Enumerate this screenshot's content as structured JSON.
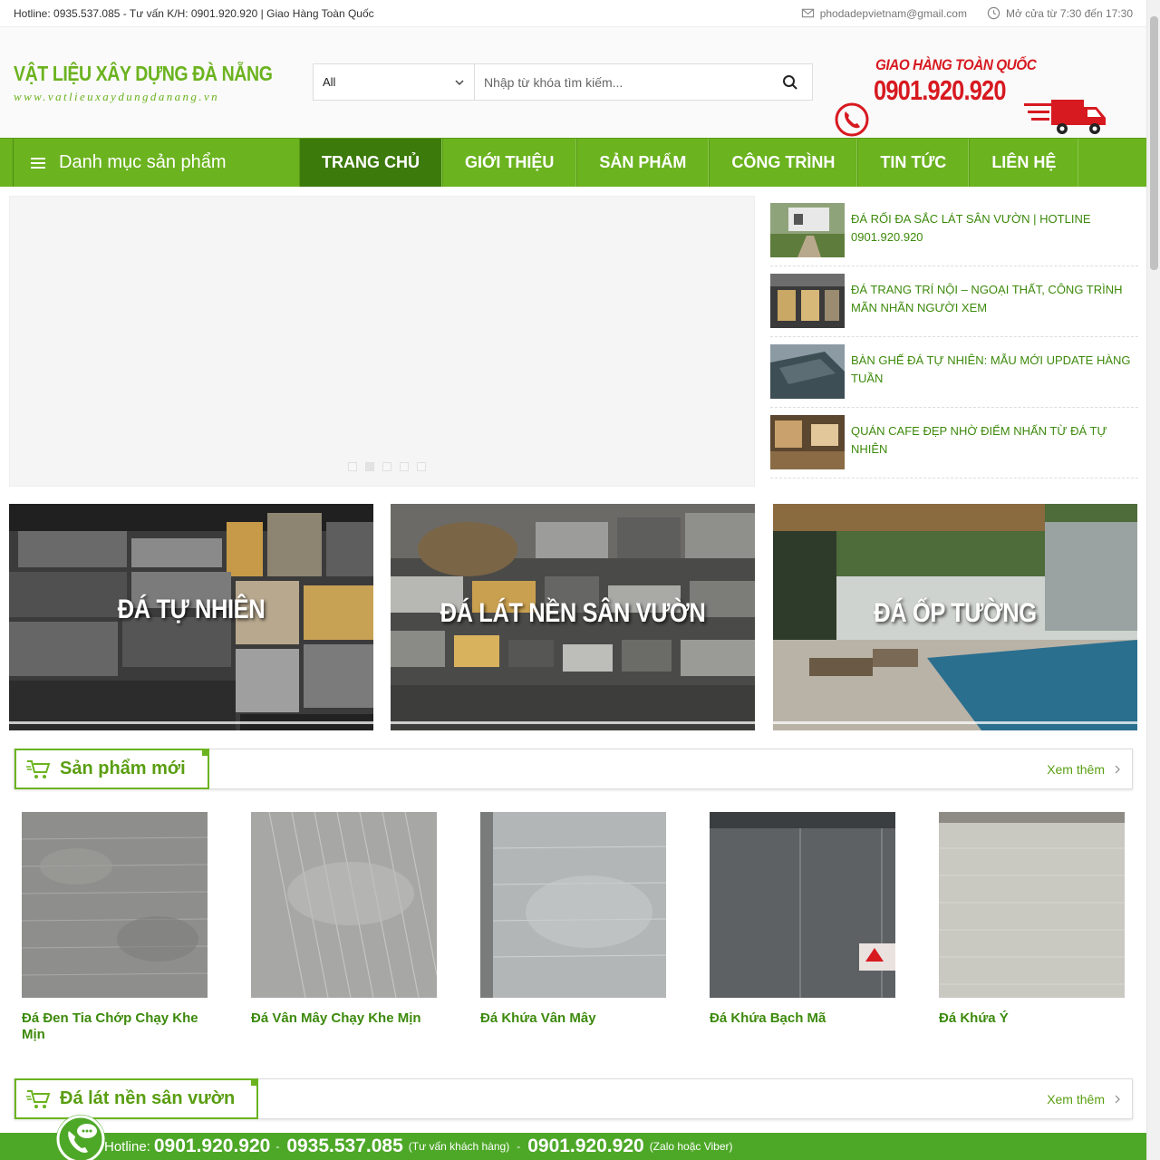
{
  "topbar": {
    "hotline_text": "Hotline: 0935.537.085 - Tư vấn K/H: 0901.920.920 | Giao Hàng Toàn Quốc",
    "email": "phodadepvietnam@gmail.com",
    "hours": "Mở cửa từ 7:30 đến 17:30"
  },
  "logo": {
    "brand": "VẬT LIỆU XÂY DỰNG ĐÀ NẴNG",
    "url": "www.vatlieuxaydungdanang.vn"
  },
  "search": {
    "category": "All",
    "placeholder": "Nhập từ khóa tìm kiếm..."
  },
  "hotline_banner": {
    "label": "GIAO HÀNG TOÀN QUỐC",
    "number": "0901.920.920"
  },
  "nav": {
    "category_label": "Danh mục sản phẩm",
    "items": [
      "TRANG CHỦ",
      "GIỚI THIỆU",
      "SẢN PHẨM",
      "CÔNG TRÌNH",
      "TIN TỨC",
      "LIÊN HỆ"
    ],
    "active_index": 0
  },
  "news": [
    {
      "title": "ĐÁ RỐI ĐA SẮC LÁT SÂN VƯỜN | HOTLINE 0901.920.920"
    },
    {
      "title": "ĐÁ TRANG TRÍ NỘI – NGOẠI THẤT, CÔNG TRÌNH MÃN NHÃN NGƯỜI XEM"
    },
    {
      "title": "BÀN GHẾ ĐÁ TỰ NHIÊN: MẪU MỚI UPDATE HÀNG TUẦN"
    },
    {
      "title": "QUÁN CAFE ĐẸP NHỜ ĐIỂM NHẤN TỪ ĐÁ TỰ NHIÊN"
    }
  ],
  "banners": [
    {
      "label": "ĐÁ TỰ NHIÊN"
    },
    {
      "label": "ĐÁ LÁT NỀN SÂN VƯỜN"
    },
    {
      "label": "ĐÁ ỐP TƯỜNG"
    }
  ],
  "sections": [
    {
      "title": "Sản phẩm mới",
      "more": "Xem thêm"
    },
    {
      "title": "Đá lát nền sân vườn",
      "more": "Xem thêm"
    }
  ],
  "products": [
    {
      "name": "Đá Đen Tia Chớp Chạy Khe Mịn"
    },
    {
      "name": "Đá Vân Mây Chạy Khe Mịn"
    },
    {
      "name": "Đá Khứa Vân Mây"
    },
    {
      "name": "Đá Khứa Bạch Mã"
    },
    {
      "name": "Đá Khứa Ý"
    }
  ],
  "footer": {
    "label": "Hotline:",
    "number1": "0901.920.920",
    "sep": "-",
    "number2": "0935.537.085",
    "note2": "(Tư vấn khách hàng)",
    "number3": "0901.920.920",
    "note3": "(Zalo hoặc Viber)"
  },
  "colors": {
    "brand_green": "#6bb31f",
    "nav_active": "#3d7a0c",
    "hotline_red": "#d71920",
    "footer_green": "#4ea828"
  }
}
